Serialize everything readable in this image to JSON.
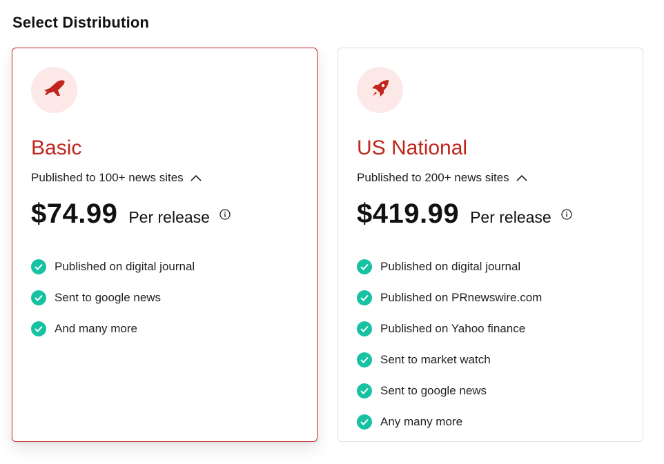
{
  "page": {
    "title": "Select Distribution"
  },
  "colors": {
    "accent": "#c0261d",
    "check": "#17c2a2",
    "icon_bg": "#fde8e8"
  },
  "plans": [
    {
      "name": "Basic",
      "icon": "airplane-icon",
      "subtitle": "Published to 100+ news sites",
      "price": "$74.99",
      "per": "Per release",
      "selected": true,
      "features": [
        "Published on digital journal",
        "Sent to google news",
        "And many more"
      ]
    },
    {
      "name": "US National",
      "icon": "rocket-icon",
      "subtitle": "Published to 200+ news sites",
      "price": "$419.99",
      "per": "Per release",
      "selected": false,
      "features": [
        "Published on digital journal",
        "Published on PRnewswire.com",
        "Published on Yahoo finance",
        "Sent to market watch",
        "Sent to google news",
        "Any many more"
      ]
    }
  ]
}
